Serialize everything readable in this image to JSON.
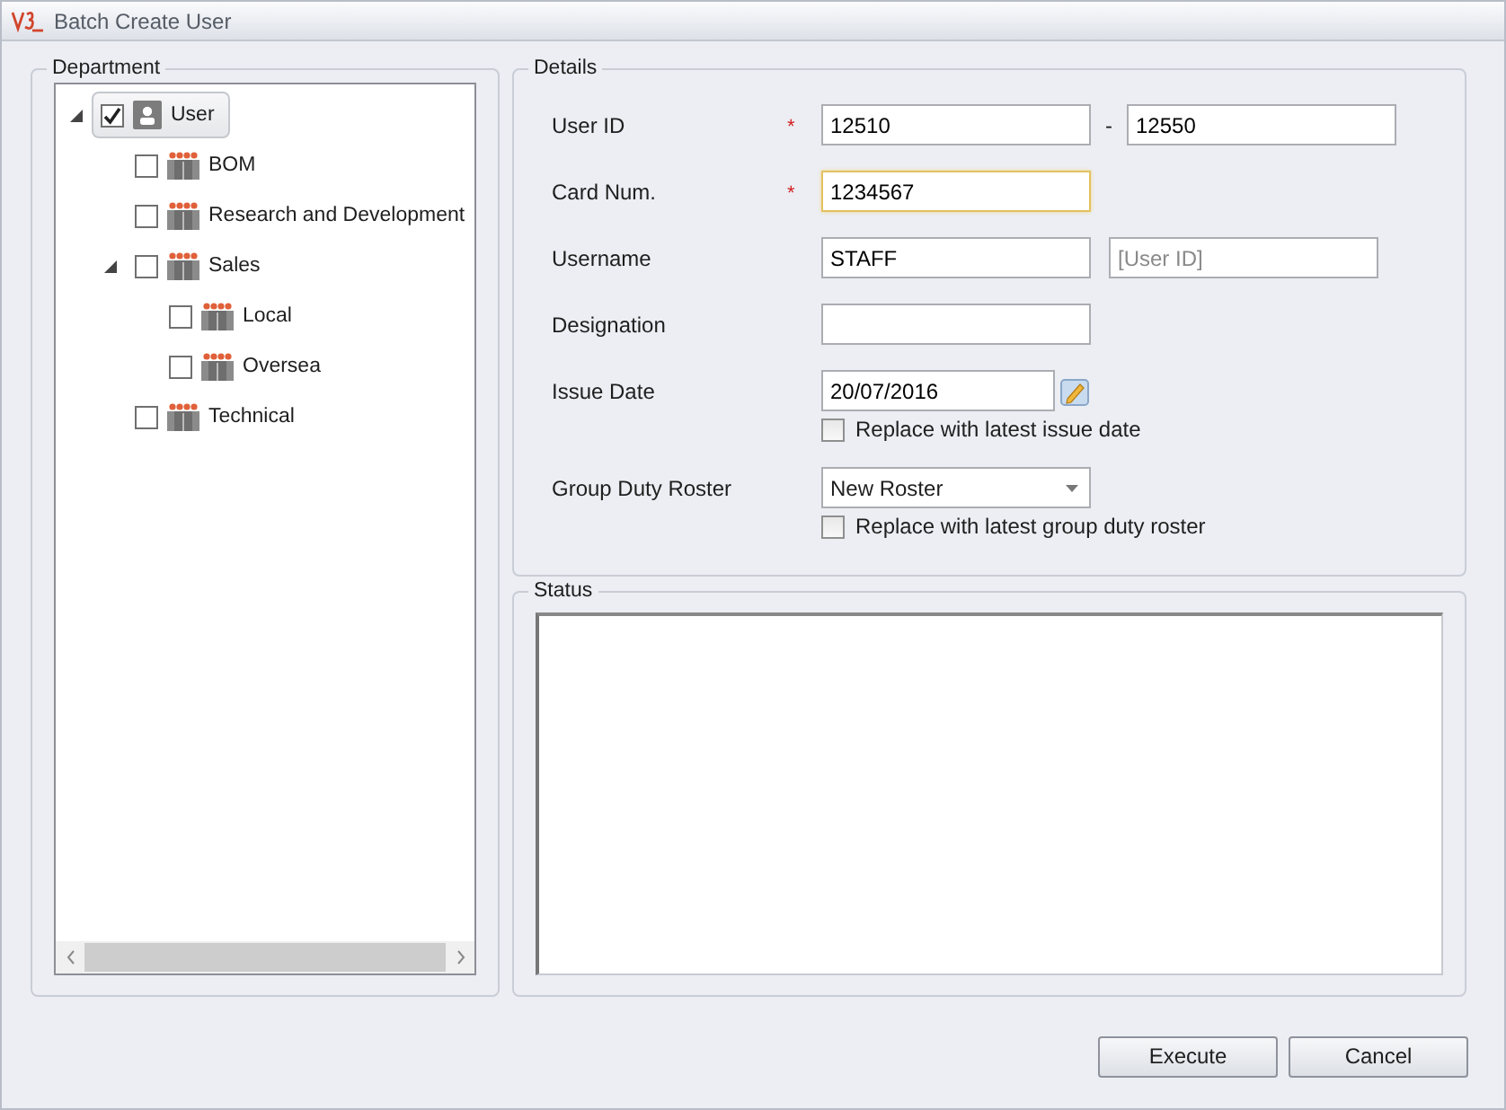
{
  "window": {
    "title": "Batch Create User"
  },
  "department": {
    "title": "Department",
    "tree": [
      {
        "label": "User",
        "kind": "person",
        "checked": true,
        "selected": true,
        "expanded": true,
        "children": [
          {
            "label": "BOM",
            "kind": "group",
            "checked": false,
            "selected": false
          },
          {
            "label": "Research and Development",
            "kind": "group",
            "checked": false,
            "selected": false
          },
          {
            "label": "Sales",
            "kind": "group",
            "checked": false,
            "selected": false,
            "expanded": true,
            "children": [
              {
                "label": "Local",
                "kind": "group",
                "checked": false,
                "selected": false
              },
              {
                "label": "Oversea",
                "kind": "group",
                "checked": false,
                "selected": false
              }
            ]
          },
          {
            "label": "Technical",
            "kind": "group",
            "checked": false,
            "selected": false
          }
        ]
      }
    ]
  },
  "details": {
    "title": "Details",
    "rows": [
      {
        "kind": "range",
        "label": "User ID",
        "marker": "*",
        "from": "12510",
        "separator": "-",
        "to": "12550"
      },
      {
        "kind": "text",
        "label": "Card Num.",
        "marker": "*",
        "value": "1234567",
        "focused": true
      },
      {
        "kind": "pair",
        "label": "Username",
        "value": "STAFF",
        "placeholder": "[User ID]"
      },
      {
        "kind": "text",
        "label": "Designation",
        "focused": false
      },
      {
        "kind": "date",
        "label": "Issue Date",
        "value": "20/07/2016",
        "option": {
          "label": "Replace with latest issue date",
          "checked": false
        }
      },
      {
        "kind": "select",
        "label": "Group Duty Roster",
        "value": "New Roster",
        "option": {
          "label": "Replace with latest group duty roster",
          "checked": false
        }
      }
    ]
  },
  "status": {
    "title": "Status"
  },
  "buttons": [
    {
      "label": "Execute"
    },
    {
      "label": "Cancel"
    }
  ]
}
